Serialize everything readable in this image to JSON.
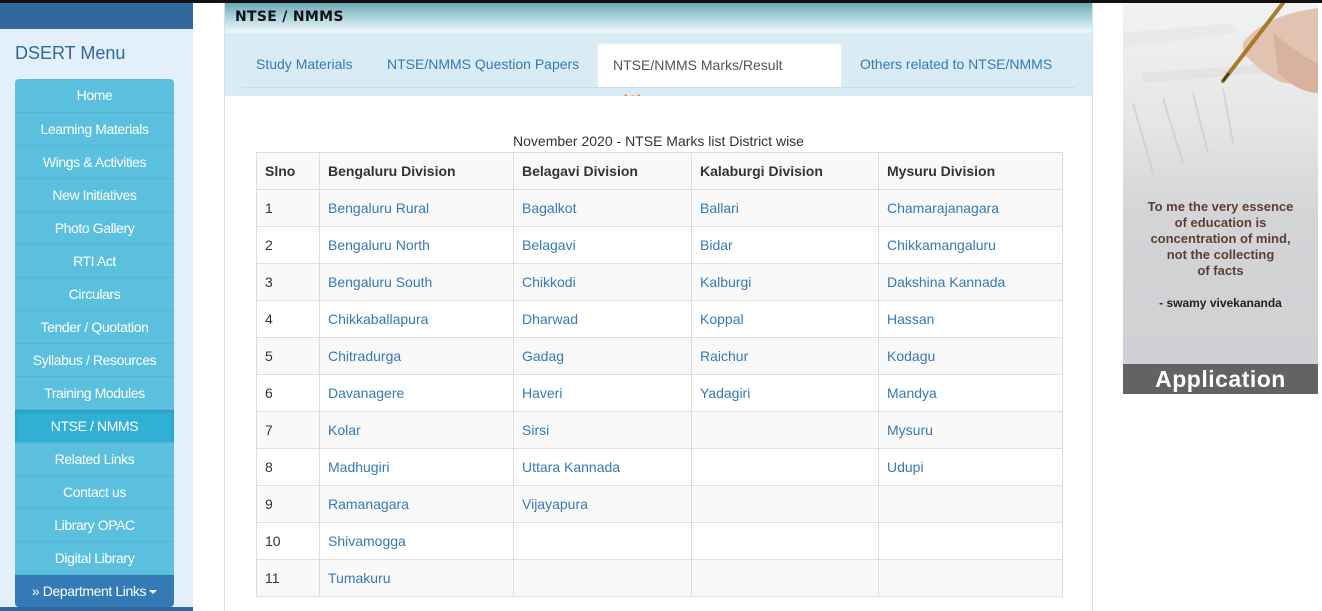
{
  "sidebar": {
    "title": "DSERT Menu",
    "items": [
      {
        "label": "Home"
      },
      {
        "label": "Learning Materials"
      },
      {
        "label": "Wings & Activities"
      },
      {
        "label": "New Initiatives"
      },
      {
        "label": "Photo Gallery"
      },
      {
        "label": "RTI Act"
      },
      {
        "label": "Circulars"
      },
      {
        "label": "Tender / Quotation"
      },
      {
        "label": "Syllabus / Resources"
      },
      {
        "label": "Training Modules"
      },
      {
        "label": "NTSE / NMMS"
      },
      {
        "label": "Related Links"
      },
      {
        "label": "Contact us"
      },
      {
        "label": "Library OPAC"
      },
      {
        "label": "Digital Library"
      }
    ],
    "active_item": "NTSE / NMMS",
    "department_links_label": "» Department Links"
  },
  "panel": {
    "title": "NTSE / NMMS",
    "tabs": [
      {
        "label": "Study Materials"
      },
      {
        "label": "NTSE/NMMS Question Papers"
      },
      {
        "label": "NTSE/NMMS Marks/Result"
      },
      {
        "label": "Others related to NTSE/NMMS"
      }
    ],
    "active_tab": "NTSE/NMMS Marks/Result",
    "new_badge": "New"
  },
  "marks_table": {
    "caption": "November 2020 - NTSE Marks list District wise",
    "headers": [
      "Slno",
      "Bengaluru Division",
      "Belagavi Division",
      "Kalaburgi Division",
      "Mysuru Division"
    ],
    "rows": [
      [
        "1",
        "Bengaluru Rural",
        "Bagalkot",
        "Ballari",
        "Chamarajanagara"
      ],
      [
        "2",
        "Bengaluru North",
        "Belagavi",
        "Bidar",
        "Chikkamangaluru"
      ],
      [
        "3",
        "Bengaluru South",
        "Chikkodi",
        "Kalburgi",
        "Dakshina Kannada"
      ],
      [
        "4",
        "Chikkaballapura",
        "Dharwad",
        "Koppal",
        "Hassan"
      ],
      [
        "5",
        "Chitradurga",
        "Gadag",
        "Raichur",
        "Kodagu"
      ],
      [
        "6",
        "Davanagere",
        "Haveri",
        "Yadagiri",
        "Mandya"
      ],
      [
        "7",
        "Kolar",
        "Sirsi",
        "",
        "Mysuru"
      ],
      [
        "8",
        "Madhugiri",
        "Uttara Kannada",
        "",
        "Udupi"
      ],
      [
        "9",
        "Ramanagara",
        "Vijayapura",
        "",
        ""
      ],
      [
        "10",
        "Shivamogga",
        "",
        "",
        ""
      ],
      [
        "11",
        "Tumakuru",
        "",
        "",
        ""
      ]
    ]
  },
  "banner": {
    "quote_lines": [
      "To me the very essence",
      "of education is",
      "concentration of mind,",
      "not the collecting",
      "of facts"
    ],
    "author": "- swamy vivekananda",
    "button_label": "Application"
  },
  "colors": {
    "link": "#337ab7",
    "menu_bg": "#5bc0de",
    "menu_active": "#31b0d5",
    "dept_links": "#337ab7",
    "sidebar_header": "#31679c",
    "new_badge": "#f07d00"
  }
}
